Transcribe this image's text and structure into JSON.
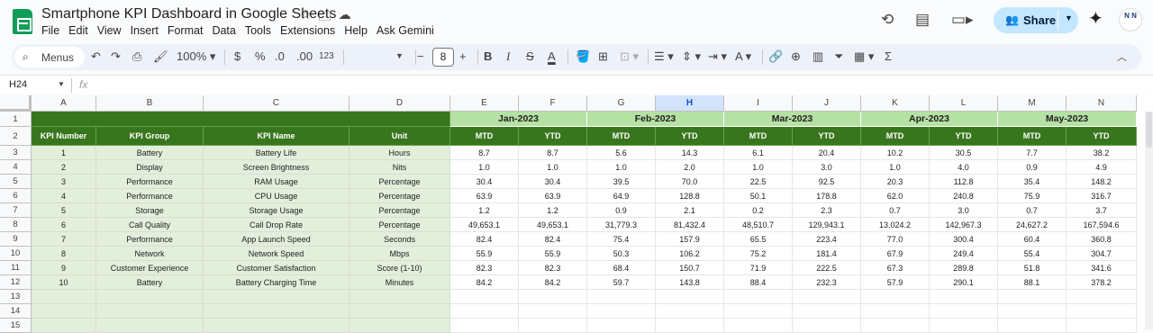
{
  "doc": {
    "title": "Smartphone KPI Dashboard in Google Sheets",
    "menu": [
      "File",
      "Edit",
      "View",
      "Insert",
      "Format",
      "Data",
      "Tools",
      "Extensions",
      "Help",
      "Ask Gemini"
    ],
    "share_label": "Share",
    "avatar_text": "N N"
  },
  "toolbar": {
    "menus_label": "Menus",
    "zoom": "100%",
    "currency": "$",
    "percent": "%",
    "dec_decrease": ".0",
    "dec_increase": ".00",
    "number_format": "123",
    "font_size": "8",
    "bold": "B",
    "italic": "I",
    "text_color": "A",
    "sigma": "Σ"
  },
  "formula_bar": {
    "name_box": "H24",
    "fx": "fx"
  },
  "sheet": {
    "columns": [
      "A",
      "B",
      "C",
      "D",
      "E",
      "F",
      "G",
      "H",
      "I",
      "J",
      "K",
      "L",
      "M",
      "N"
    ],
    "selected_column": "H",
    "rows": [
      "1",
      "2",
      "3",
      "4",
      "5",
      "6",
      "7",
      "8",
      "9",
      "10",
      "11",
      "12",
      "13",
      "14",
      "15"
    ],
    "months": [
      "Jan-2023",
      "Feb-2023",
      "Mar-2023",
      "Apr-2023",
      "May-2023"
    ],
    "headers": [
      "KPI Number",
      "KPI Group",
      "KPI Name",
      "Unit",
      "MTD",
      "YTD",
      "MTD",
      "YTD",
      "MTD",
      "YTD",
      "MTD",
      "YTD",
      "MTD",
      "YTD"
    ],
    "data": [
      [
        "1",
        "Battery",
        "Battery Life",
        "Hours",
        "8.7",
        "8.7",
        "5.6",
        "14.3",
        "6.1",
        "20.4",
        "10.2",
        "30.5",
        "7.7",
        "38.2"
      ],
      [
        "2",
        "Display",
        "Screen Brightness",
        "Nits",
        "1.0",
        "1.0",
        "1.0",
        "2.0",
        "1.0",
        "3.0",
        "1.0",
        "4.0",
        "0.9",
        "4.9"
      ],
      [
        "3",
        "Performance",
        "RAM Usage",
        "Percentage",
        "30.4",
        "30.4",
        "39.5",
        "70.0",
        "22.5",
        "92.5",
        "20.3",
        "112.8",
        "35.4",
        "148.2"
      ],
      [
        "4",
        "Performance",
        "CPU Usage",
        "Percentage",
        "63.9",
        "63.9",
        "64.9",
        "128.8",
        "50.1",
        "178.8",
        "62.0",
        "240.8",
        "75.9",
        "316.7"
      ],
      [
        "5",
        "Storage",
        "Storage Usage",
        "Percentage",
        "1.2",
        "1.2",
        "0.9",
        "2.1",
        "0.2",
        "2.3",
        "0.7",
        "3.0",
        "0.7",
        "3.7"
      ],
      [
        "6",
        "Call Quality",
        "Call Drop Rate",
        "Percentage",
        "49,653.1",
        "49,653.1",
        "31,779.3",
        "81,432.4",
        "48,510.7",
        "129,943.1",
        "13,024.2",
        "142,967.3",
        "24,627.2",
        "167,594.6"
      ],
      [
        "7",
        "Performance",
        "App Launch Speed",
        "Seconds",
        "82.4",
        "82.4",
        "75.4",
        "157.9",
        "65.5",
        "223.4",
        "77.0",
        "300.4",
        "60.4",
        "360.8"
      ],
      [
        "8",
        "Network",
        "Network Speed",
        "Mbps",
        "55.9",
        "55.9",
        "50.3",
        "106.2",
        "75.2",
        "181.4",
        "67.9",
        "249.4",
        "55.4",
        "304.7"
      ],
      [
        "9",
        "Customer Experience",
        "Customer Satisfaction",
        "Score (1-10)",
        "82.3",
        "82.3",
        "68.4",
        "150.7",
        "71.9",
        "222.5",
        "67.3",
        "289.8",
        "51.8",
        "341.6"
      ],
      [
        "10",
        "Battery",
        "Battery Charging Time",
        "Minutes",
        "84.2",
        "84.2",
        "59.7",
        "143.8",
        "88.4",
        "232.3",
        "57.9",
        "290.1",
        "88.1",
        "378.2"
      ]
    ]
  }
}
